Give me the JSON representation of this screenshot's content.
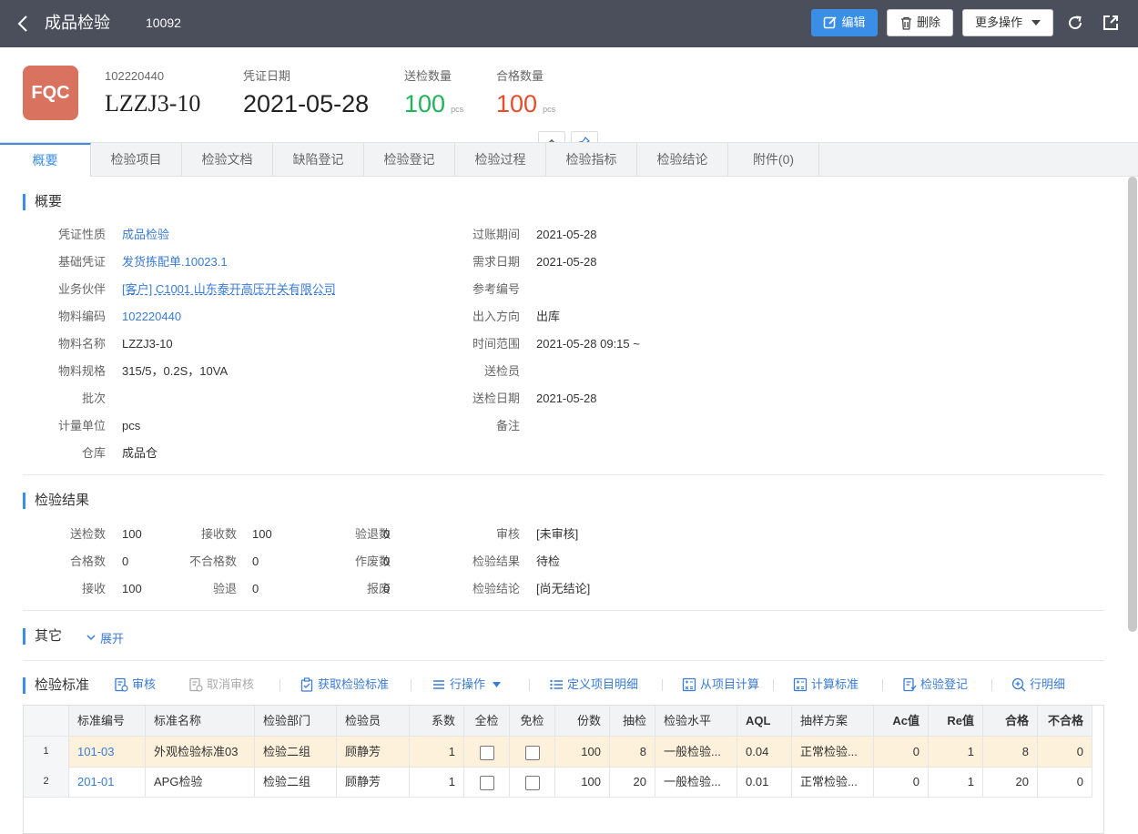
{
  "topbar": {
    "title": "成品检验",
    "doc_no": "10092",
    "edit_label": "编辑",
    "delete_label": "删除",
    "more_label": "更多操作"
  },
  "header": {
    "logo_text": "FQC",
    "material_code_label": "102220440",
    "material_code": "LZZJ3-10",
    "voucher_date_label": "凭证日期",
    "voucher_date": "2021-05-28",
    "sent_qty_label": "送检数量",
    "sent_qty": "100",
    "sent_unit": "pcs",
    "pass_qty_label": "合格数量",
    "pass_qty": "100",
    "pass_unit": "pcs"
  },
  "tabs": [
    "概要",
    "检验项目",
    "检验文档",
    "缺陷登记",
    "检验登记",
    "检验过程",
    "检验指标",
    "检验结论",
    "附件(0)"
  ],
  "summary": {
    "title": "概要",
    "left": [
      {
        "label": "凭证性质",
        "value": "成品检验"
      },
      {
        "label": "基础凭证",
        "value": "发货拣配单.10023.1"
      },
      {
        "label": "业务伙伴",
        "value": "[客户] C1001 山东泰开高压开关有限公司"
      },
      {
        "label": "物料编码",
        "value": "102220440"
      },
      {
        "label": "物料名称",
        "value": "LZZJ3-10"
      },
      {
        "label": "物料规格",
        "value": "315/5，0.2S，10VA"
      },
      {
        "label": "批次",
        "value": ""
      },
      {
        "label": "计量单位",
        "value": "pcs"
      },
      {
        "label": "仓库",
        "value": "成品仓"
      }
    ],
    "right": [
      {
        "label": "过账期间",
        "value": "2021-05-28"
      },
      {
        "label": "需求日期",
        "value": "2021-05-28"
      },
      {
        "label": "参考编号",
        "value": ""
      },
      {
        "label": "出入方向",
        "value": "出库"
      },
      {
        "label": "时间范围",
        "value": "2021-05-28 09:15 ~"
      },
      {
        "label": "送检员",
        "value": ""
      },
      {
        "label": "送检日期",
        "value": "2021-05-28"
      },
      {
        "label": "备注",
        "value": ""
      }
    ]
  },
  "result": {
    "title": "检验结果",
    "col1": [
      {
        "label": "送检数",
        "value": "100"
      },
      {
        "label": "合格数",
        "value": "0"
      },
      {
        "label": "接收",
        "value": "100"
      }
    ],
    "col2": [
      {
        "label": "接收数",
        "value": "100"
      },
      {
        "label": "不合格数",
        "value": "0"
      },
      {
        "label": "验退",
        "value": "0"
      }
    ],
    "col3": [
      {
        "label": "验退数",
        "value": "0"
      },
      {
        "label": "作废数",
        "value": "0"
      },
      {
        "label": "报废",
        "value": "0"
      }
    ],
    "col4": [
      {
        "label": "审核",
        "value": "[未审核]"
      },
      {
        "label": "检验结果",
        "value": "待检"
      },
      {
        "label": "检验结论",
        "value": "[尚无结论]"
      }
    ]
  },
  "other": {
    "title": "其它",
    "expand_label": "展开"
  },
  "standards": {
    "title": "检验标准",
    "toolbar": [
      {
        "label": "审核",
        "icon": "audit-icon"
      },
      {
        "label": "取消审核",
        "icon": "cancel-audit-icon"
      },
      {
        "label": "获取检验标准",
        "icon": "clipboard-icon"
      },
      {
        "label": "行操作",
        "icon": "list-icon"
      },
      {
        "label": "定义项目明细",
        "icon": "list-detail-icon"
      },
      {
        "label": "从项目计算",
        "icon": "calculator-icon"
      },
      {
        "label": "计算标准",
        "icon": "calculator-icon"
      },
      {
        "label": "检验登记",
        "icon": "register-icon"
      },
      {
        "label": "行明细",
        "icon": "zoom-in-icon"
      }
    ],
    "columns": [
      "标准编号",
      "标准名称",
      "检验部门",
      "检验员",
      "系数",
      "全检",
      "免检",
      "份数",
      "抽检",
      "检验水平",
      "AQL",
      "抽样方案",
      "Ac值",
      "Re值",
      "合格",
      "不合格"
    ],
    "rows": [
      {
        "no": "1",
        "code": "101-03",
        "name": "外观检验标准03",
        "dept": "检验二组",
        "inspector": "顾静芳",
        "coef": "1",
        "full": false,
        "exempt": false,
        "copies": "100",
        "sample": "8",
        "level": "一般检验...",
        "aql": "0.04",
        "plan": "正常检验...",
        "ac": "0",
        "re": "1",
        "pass": "8",
        "fail": "0"
      },
      {
        "no": "2",
        "code": "201-01",
        "name": "APG检验",
        "dept": "检验二组",
        "inspector": "顾静芳",
        "coef": "1",
        "full": false,
        "exempt": false,
        "copies": "100",
        "sample": "20",
        "level": "一般检验...",
        "aql": "0.01",
        "plan": "正常检验...",
        "ac": "0",
        "re": "1",
        "pass": "20",
        "fail": "0"
      }
    ]
  }
}
